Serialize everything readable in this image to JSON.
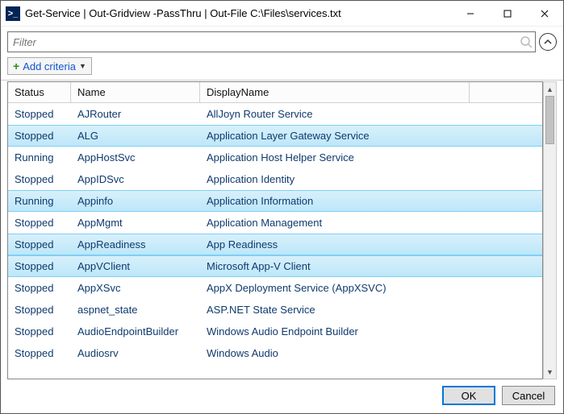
{
  "titlebar": {
    "title": "Get-Service | Out-Gridview -PassThru | Out-File C:\\Files\\services.txt"
  },
  "filter": {
    "placeholder": "Filter",
    "value": ""
  },
  "criteria": {
    "add_label": "Add criteria"
  },
  "grid": {
    "headers": {
      "status": "Status",
      "name": "Name",
      "display": "DisplayName"
    },
    "rows": [
      {
        "status": "Stopped",
        "name": "AJRouter",
        "display": "AllJoyn Router Service",
        "selected": false
      },
      {
        "status": "Stopped",
        "name": "ALG",
        "display": "Application Layer Gateway Service",
        "selected": true
      },
      {
        "status": "Running",
        "name": "AppHostSvc",
        "display": "Application Host Helper Service",
        "selected": false
      },
      {
        "status": "Stopped",
        "name": "AppIDSvc",
        "display": "Application Identity",
        "selected": false
      },
      {
        "status": "Running",
        "name": "Appinfo",
        "display": "Application Information",
        "selected": true
      },
      {
        "status": "Stopped",
        "name": "AppMgmt",
        "display": "Application Management",
        "selected": false
      },
      {
        "status": "Stopped",
        "name": "AppReadiness",
        "display": "App Readiness",
        "selected": true
      },
      {
        "status": "Stopped",
        "name": "AppVClient",
        "display": "Microsoft App-V Client",
        "selected": true
      },
      {
        "status": "Stopped",
        "name": "AppXSvc",
        "display": "AppX Deployment Service (AppXSVC)",
        "selected": false
      },
      {
        "status": "Stopped",
        "name": "aspnet_state",
        "display": "ASP.NET State Service",
        "selected": false
      },
      {
        "status": "Stopped",
        "name": "AudioEndpointBuilder",
        "display": "Windows Audio Endpoint Builder",
        "selected": false
      },
      {
        "status": "Stopped",
        "name": "Audiosrv",
        "display": "Windows Audio",
        "selected": false
      }
    ]
  },
  "footer": {
    "ok": "OK",
    "cancel": "Cancel"
  }
}
